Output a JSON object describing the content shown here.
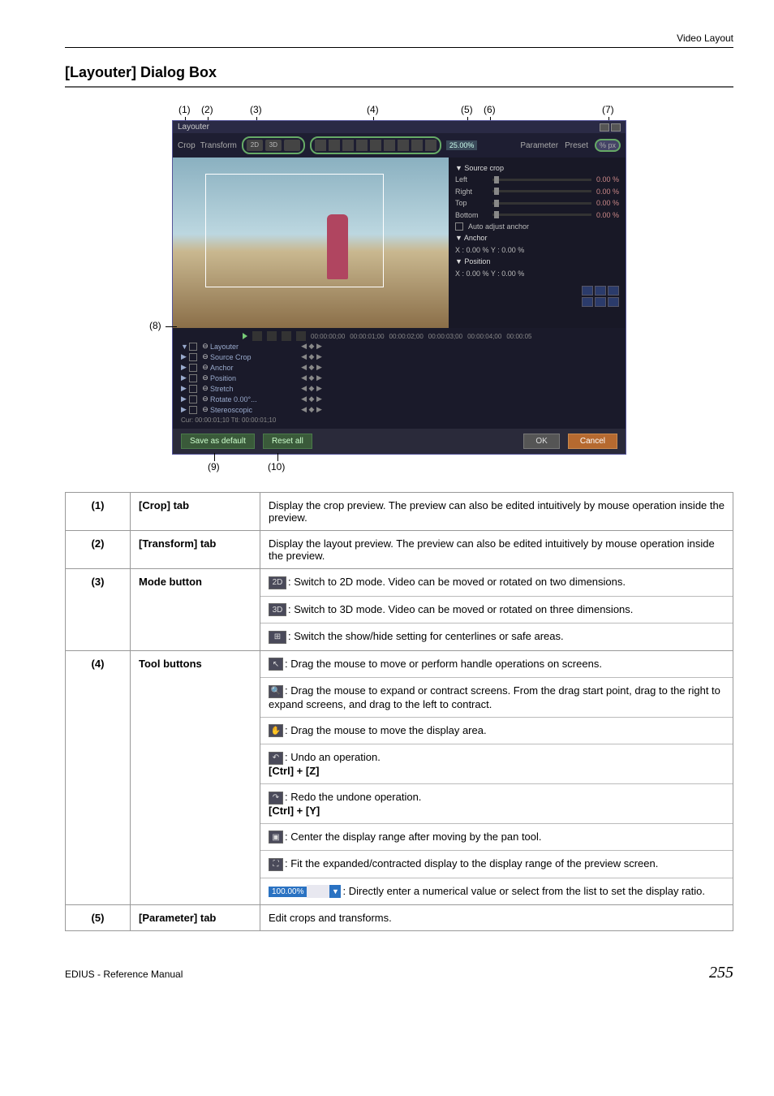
{
  "header": {
    "breadcrumb": "Video Layout"
  },
  "section": {
    "title": "[Layouter] Dialog Box"
  },
  "callouts": {
    "c1": "(1)",
    "c2": "(2)",
    "c3": "(3)",
    "c4": "(4)",
    "c5": "(5)",
    "c6": "(6)",
    "c7": "(7)",
    "c8": "(8)",
    "c9": "(9)",
    "c10": "(10)"
  },
  "dialog": {
    "title": "Layouter",
    "tabs": {
      "crop": "Crop",
      "transform": "Transform"
    },
    "mode": {
      "m2d": "2D",
      "m3d": "3D"
    },
    "zoom": "25.00%",
    "param_tab": "Parameter",
    "preset_tab": "Preset",
    "px_mode": "% px",
    "panel": {
      "source_crop": "Source crop",
      "left": "Left",
      "right": "Right",
      "top": "Top",
      "bottom": "Bottom",
      "left_v": "0.00 %",
      "right_v": "0.00 %",
      "top_v": "0.00 %",
      "bottom_v": "0.00 %",
      "auto_anchor": "Auto adjust anchor",
      "anchor": "Anchor",
      "anchor_xy": "X :       0.00 %   Y :       0.00 %",
      "position": "Position",
      "position_xy": "X :       0.00 %   Y :       0.00 %"
    },
    "timeline": {
      "tc0": "00:00:00;00",
      "tc1": "00:00:01;00",
      "tc2": "00:00:02;00",
      "tc3": "00:00:03;00",
      "tc4": "00:00:04;00",
      "tc5": "00:00:05",
      "tracks": [
        {
          "arrow": "▼",
          "name": "Layouter"
        },
        {
          "arrow": "▶",
          "name": "Source Crop"
        },
        {
          "arrow": "▶",
          "name": "Anchor"
        },
        {
          "arrow": "▶",
          "name": "Position"
        },
        {
          "arrow": "▶",
          "name": "Stretch"
        },
        {
          "arrow": "▶",
          "name": "Rotate   0.00°..."
        },
        {
          "arrow": "▶",
          "name": "Stereoscopic"
        }
      ],
      "cur": "Cur: 00:00:01;10     Ttl: 00:00:01;10"
    },
    "buttons": {
      "save": "Save as default",
      "reset": "Reset all",
      "ok": "OK",
      "cancel": "Cancel"
    }
  },
  "table": {
    "r1": {
      "no": "(1)",
      "label": "[Crop] tab",
      "desc": "Display the crop preview. The preview can also be edited intuitively by mouse operation inside the preview."
    },
    "r2": {
      "no": "(2)",
      "label": "[Transform] tab",
      "desc": "Display the layout preview. The preview can also be edited intuitively by mouse operation inside the preview."
    },
    "r3": {
      "no": "(3)",
      "label": "Mode button",
      "d1": ": Switch to 2D mode. Video can be moved or rotated on two dimensions.",
      "d2": ": Switch to 3D mode. Video can be moved or rotated on three dimensions.",
      "d3": ": Switch the show/hide setting for centerlines or safe areas."
    },
    "r4": {
      "no": "(4)",
      "label": "Tool buttons",
      "d1": ": Drag the mouse to move or perform handle operations on screens.",
      "d2": ": Drag the mouse to expand or contract screens. From the drag start point, drag to the right to expand screens, and drag to the left to contract.",
      "d3": ": Drag the mouse to move the display area.",
      "d4": ": Undo an operation.",
      "d4s": "[Ctrl] + [Z]",
      "d5": ": Redo the undone operation.",
      "d5s": "[Ctrl] + [Y]",
      "d6": ": Center the display range after moving by the pan tool.",
      "d7": ": Fit the expanded/contracted display to the display range of the preview screen.",
      "d8": ": Directly enter a numerical value or select from the list to set the display ratio.",
      "zoom": "100.00%"
    },
    "r5": {
      "no": "(5)",
      "label": "[Parameter] tab",
      "desc": "Edit crops and transforms."
    }
  },
  "footer": {
    "manual": "EDIUS - Reference Manual",
    "page": "255"
  }
}
